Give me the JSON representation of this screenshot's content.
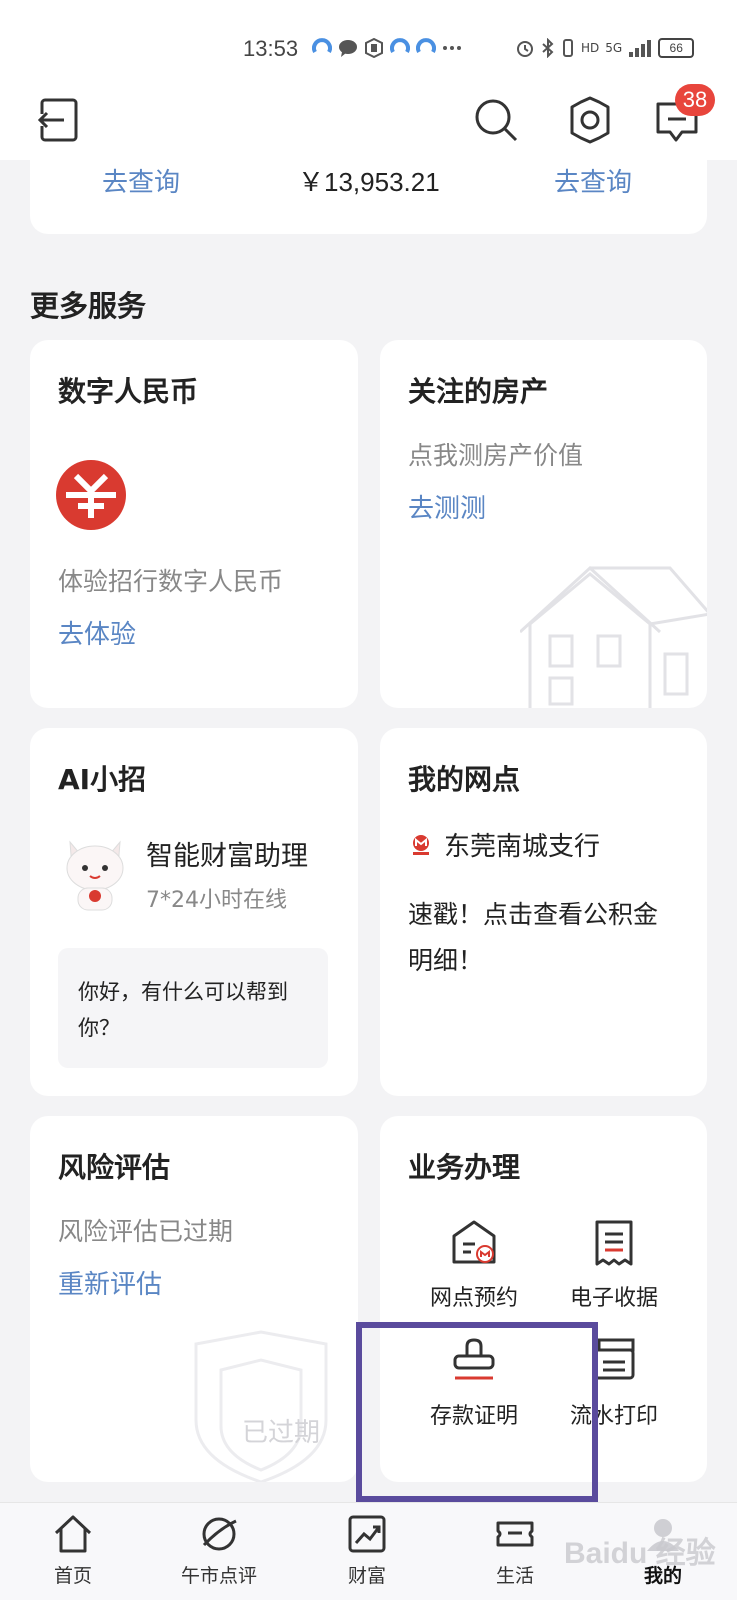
{
  "status_bar": {
    "time": "13:53",
    "network": "5G",
    "hd": "HD",
    "battery": "66"
  },
  "header": {
    "badge_count": "38"
  },
  "top_card": {
    "left_link": "去查询",
    "amount": "￥13,953.21",
    "right_link": "去查询"
  },
  "section_title": "更多服务",
  "cards": {
    "digital_rmb": {
      "title": "数字人民币",
      "subtitle": "体验招行数字人民币",
      "link": "去体验"
    },
    "property": {
      "title": "关注的房产",
      "subtitle": "点我测房产价值",
      "link": "去测测"
    },
    "ai": {
      "title": "AI小招",
      "assistant_name": "智能财富助理",
      "assistant_hours": "7*24小时在线",
      "bubble": "你好，有什么可以帮到你？"
    },
    "branch": {
      "title": "我的网点",
      "branch_name": "东莞南城支行",
      "desc": "速戳！点击查看公积金明细！"
    },
    "risk": {
      "title": "风险评估",
      "subtitle": "风险评估已过期",
      "link": "重新评估",
      "stamp": "已过期"
    },
    "business": {
      "title": "业务办理",
      "items": [
        {
          "label": "网点预约",
          "icon": "branch-booking-icon"
        },
        {
          "label": "电子收据",
          "icon": "receipt-icon"
        },
        {
          "label": "存款证明",
          "icon": "stamp-icon"
        },
        {
          "label": "流水打印",
          "icon": "printer-icon"
        }
      ]
    }
  },
  "bottom_nav": [
    {
      "label": "首页",
      "icon": "home-icon"
    },
    {
      "label": "午市点评",
      "icon": "planet-icon"
    },
    {
      "label": "财富",
      "icon": "chart-icon"
    },
    {
      "label": "生活",
      "icon": "ticket-icon"
    },
    {
      "label": "我的",
      "icon": "profile-icon"
    }
  ],
  "watermark": "Baidu 经验"
}
